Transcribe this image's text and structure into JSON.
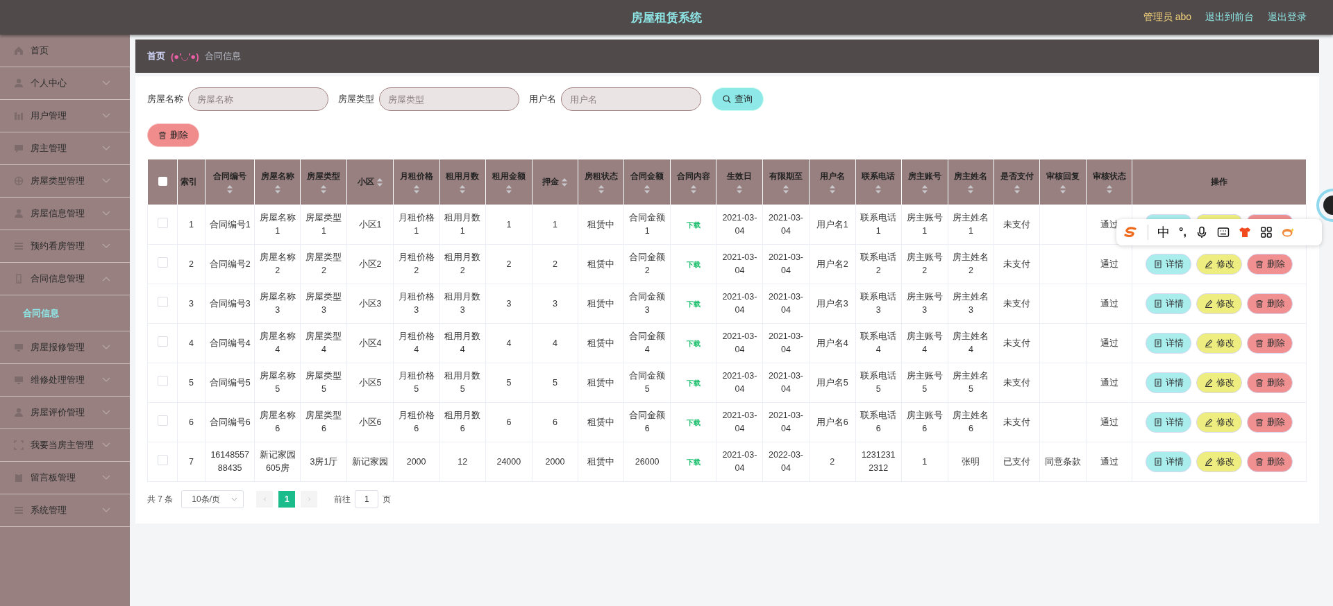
{
  "header": {
    "title": "房屋租赁系统",
    "user": "管理员 abo",
    "links": [
      "退出到前台",
      "退出登录"
    ]
  },
  "sidebar": {
    "items": [
      {
        "label": "首页"
      },
      {
        "label": "个人中心",
        "expanded": false
      },
      {
        "label": "用户管理",
        "expanded": false
      },
      {
        "label": "房主管理",
        "expanded": false
      },
      {
        "label": "房屋类型管理",
        "expanded": false
      },
      {
        "label": "房屋信息管理",
        "expanded": false
      },
      {
        "label": "预约看房管理",
        "expanded": false
      },
      {
        "label": "合同信息管理",
        "expanded": true,
        "children": [
          {
            "label": "合同信息",
            "selected": true
          }
        ]
      },
      {
        "label": "房屋报修管理",
        "expanded": false
      },
      {
        "label": "维修处理管理",
        "expanded": false
      },
      {
        "label": "房屋评价管理",
        "expanded": false
      },
      {
        "label": "我要当房主管理",
        "expanded": false
      },
      {
        "label": "留言板管理",
        "expanded": false
      },
      {
        "label": "系统管理",
        "expanded": false
      }
    ]
  },
  "breadcrumb": {
    "home": "首页",
    "separator": "(●'◡'●)",
    "current": "合同信息"
  },
  "search": {
    "fields": [
      {
        "label": "房屋名称",
        "placeholder": "房屋名称"
      },
      {
        "label": "房屋类型",
        "placeholder": "房屋类型"
      },
      {
        "label": "用户名",
        "placeholder": "用户名"
      }
    ],
    "button": "查询"
  },
  "delete_button": "删除",
  "table": {
    "header_checked": false,
    "columns": [
      {
        "label": "索引",
        "sortable": false
      },
      {
        "label": "合同编号",
        "sortable": true
      },
      {
        "label": "房屋名称",
        "sortable": true
      },
      {
        "label": "房屋类型",
        "sortable": true
      },
      {
        "label": "小区",
        "sortable": true
      },
      {
        "label": "月租价格",
        "sortable": true
      },
      {
        "label": "租用月数",
        "sortable": true
      },
      {
        "label": "租用金额",
        "sortable": true
      },
      {
        "label": "押金",
        "sortable": true
      },
      {
        "label": "房租状态",
        "sortable": true
      },
      {
        "label": "合同金额",
        "sortable": true
      },
      {
        "label": "合同内容",
        "sortable": true,
        "kind": "link"
      },
      {
        "label": "生效日",
        "sortable": true
      },
      {
        "label": "有限期至",
        "sortable": true
      },
      {
        "label": "用户名",
        "sortable": true
      },
      {
        "label": "联系电话",
        "sortable": true
      },
      {
        "label": "房主账号",
        "sortable": true
      },
      {
        "label": "房主姓名",
        "sortable": true
      },
      {
        "label": "是否支付",
        "sortable": true
      },
      {
        "label": "审核回复",
        "sortable": true
      },
      {
        "label": "审核状态",
        "sortable": true
      },
      {
        "label": "操作",
        "sortable": false,
        "kind": "actions"
      }
    ],
    "rows": [
      {
        "checked": false,
        "cells": [
          "1",
          "合同编号1",
          "房屋名称1",
          "房屋类型1",
          "小区1",
          "月租价格1",
          "租用月数1",
          "1",
          "1",
          "租赁中",
          "合同金额1",
          "下载",
          "2021-03-04",
          "2021-03-04",
          "用户名1",
          "联系电话1",
          "房主账号1",
          "房主姓名1",
          "未支付",
          null,
          "通过"
        ],
        "actions": [
          {
            "kind": "detail"
          },
          {
            "kind": "edit"
          },
          {
            "kind": "delete"
          }
        ]
      },
      {
        "checked": false,
        "cells": [
          "2",
          "合同编号2",
          "房屋名称2",
          "房屋类型2",
          "小区2",
          "月租价格2",
          "租用月数2",
          "2",
          "2",
          "租赁中",
          "合同金额2",
          "下载",
          "2021-03-04",
          "2021-03-04",
          "用户名2",
          "联系电话2",
          "房主账号2",
          "房主姓名2",
          "未支付",
          null,
          "通过"
        ],
        "actions": [
          {
            "kind": "detail",
            "label": "详情"
          },
          {
            "kind": "edit",
            "label": "修改"
          },
          {
            "kind": "delete",
            "label": "删除"
          }
        ]
      },
      {
        "checked": false,
        "cells": [
          "3",
          "合同编号3",
          "房屋名称3",
          "房屋类型3",
          "小区3",
          "月租价格3",
          "租用月数3",
          "3",
          "3",
          "租赁中",
          "合同金额3",
          "下载",
          "2021-03-04",
          "2021-03-04",
          "用户名3",
          "联系电话3",
          "房主账号3",
          "房主姓名3",
          "未支付",
          null,
          "通过"
        ],
        "actions": [
          {
            "kind": "detail",
            "label": "详情"
          },
          {
            "kind": "edit",
            "label": "修改"
          },
          {
            "kind": "delete",
            "label": "删除"
          }
        ]
      },
      {
        "checked": false,
        "cells": [
          "4",
          "合同编号4",
          "房屋名称4",
          "房屋类型4",
          "小区4",
          "月租价格4",
          "租用月数4",
          "4",
          "4",
          "租赁中",
          "合同金额4",
          "下载",
          "2021-03-04",
          "2021-03-04",
          "用户名4",
          "联系电话4",
          "房主账号4",
          "房主姓名4",
          "未支付",
          null,
          "通过"
        ],
        "actions": [
          {
            "kind": "detail",
            "label": "详情"
          },
          {
            "kind": "edit",
            "label": "修改"
          },
          {
            "kind": "delete",
            "label": "删除"
          }
        ]
      },
      {
        "checked": false,
        "cells": [
          "5",
          "合同编号5",
          "房屋名称5",
          "房屋类型5",
          "小区5",
          "月租价格5",
          "租用月数5",
          "5",
          "5",
          "租赁中",
          "合同金额5",
          "下载",
          "2021-03-04",
          "2021-03-04",
          "用户名5",
          "联系电话5",
          "房主账号5",
          "房主姓名5",
          "未支付",
          null,
          "通过"
        ],
        "actions": [
          {
            "kind": "detail",
            "label": "详情"
          },
          {
            "kind": "edit",
            "label": "修改"
          },
          {
            "kind": "delete",
            "label": "删除"
          }
        ]
      },
      {
        "checked": false,
        "cells": [
          "6",
          "合同编号6",
          "房屋名称6",
          "房屋类型6",
          "小区6",
          "月租价格6",
          "租用月数6",
          "6",
          "6",
          "租赁中",
          "合同金额6",
          "下载",
          "2021-03-04",
          "2021-03-04",
          "用户名6",
          "联系电话6",
          "房主账号6",
          "房主姓名6",
          "未支付",
          null,
          "通过"
        ],
        "actions": [
          {
            "kind": "detail",
            "label": "详情"
          },
          {
            "kind": "edit",
            "label": "修改"
          },
          {
            "kind": "delete",
            "label": "删除"
          }
        ]
      },
      {
        "checked": false,
        "cells": [
          "7",
          "1614855788435",
          "新记家园605房",
          "3房1厅",
          "新记家园",
          "2000",
          "12",
          "24000",
          "2000",
          "租赁中",
          "26000",
          "下载",
          "2021-03-04",
          "2022-03-04",
          "2",
          "12312312312",
          "1",
          "张明",
          "已支付",
          "同意条款",
          "通过"
        ],
        "actions": [
          {
            "kind": "detail",
            "label": "详情"
          },
          {
            "kind": "edit",
            "label": "修改"
          },
          {
            "kind": "delete",
            "label": "删除"
          }
        ]
      }
    ]
  },
  "pagination": {
    "total": "共 7 条",
    "page_size": "10条/页",
    "pages": [
      {
        "label": "1",
        "selected": true
      }
    ],
    "goto_label": "前往",
    "goto_value": "1",
    "page_suffix": "页"
  },
  "ime_toolbar": {
    "mode": "中",
    "punct": "°,"
  }
}
